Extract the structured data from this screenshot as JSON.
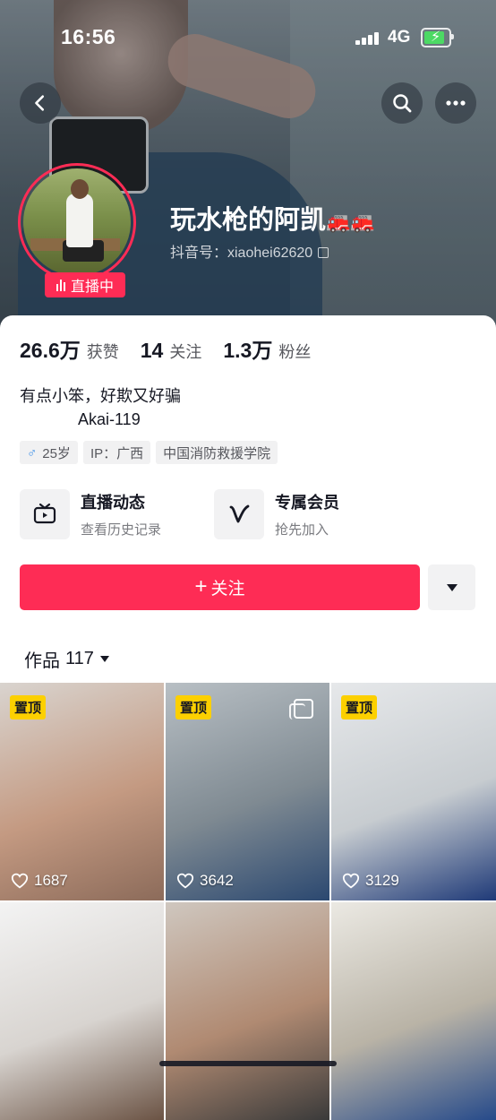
{
  "status_bar": {
    "time": "16:56",
    "network": "4G"
  },
  "profile": {
    "nickname": "玩水枪的阿凯",
    "nickname_emoji": "🚒🚒",
    "douyin_id": "抖音号：xiaohei62620",
    "live_badge": "直播中",
    "stats": [
      {
        "value": "26.6万",
        "label": "获赞"
      },
      {
        "value": "14",
        "label": "关注"
      },
      {
        "value": "1.3万",
        "label": "粉丝"
      }
    ],
    "bio_line1": "有点小笨，好欺又好骗",
    "bio_line2": "Akai-119",
    "tags": {
      "gender_symbol": "♂",
      "age": "25岁",
      "ip": "IP：广西",
      "school": "中国消防救援学院"
    }
  },
  "features": {
    "live": {
      "title": "直播动态",
      "subtitle": "查看历史记录"
    },
    "vip": {
      "title": "专属会员",
      "subtitle": "抢先加入"
    }
  },
  "actions": {
    "follow_label": "关注",
    "follow_plus": "+"
  },
  "works_tab": {
    "label": "作品",
    "count": "117"
  },
  "videos": [
    {
      "pinned": "置顶",
      "likes": "1687",
      "colors": [
        "#d9d4cf",
        "#c49a82",
        "#8c6b5a"
      ]
    },
    {
      "pinned": "置顶",
      "likes": "3642",
      "colors": [
        "#b8bfc4",
        "#7f8a92",
        "#2b4870"
      ]
    },
    {
      "pinned": "置顶",
      "likes": "3129",
      "colors": [
        "#e6e8ea",
        "#c7ccd0",
        "#1f3a78"
      ]
    },
    {
      "pinned": "",
      "likes": "",
      "colors": [
        "#f3f3f3",
        "#d8d4d0",
        "#6b5344"
      ]
    },
    {
      "pinned": "",
      "likes": "",
      "colors": [
        "#cfc7bf",
        "#b08a72",
        "#3a3a3a"
      ]
    },
    {
      "pinned": "",
      "likes": "",
      "colors": [
        "#ebe9e3",
        "#b9b3a6",
        "#264a8a"
      ]
    }
  ]
}
